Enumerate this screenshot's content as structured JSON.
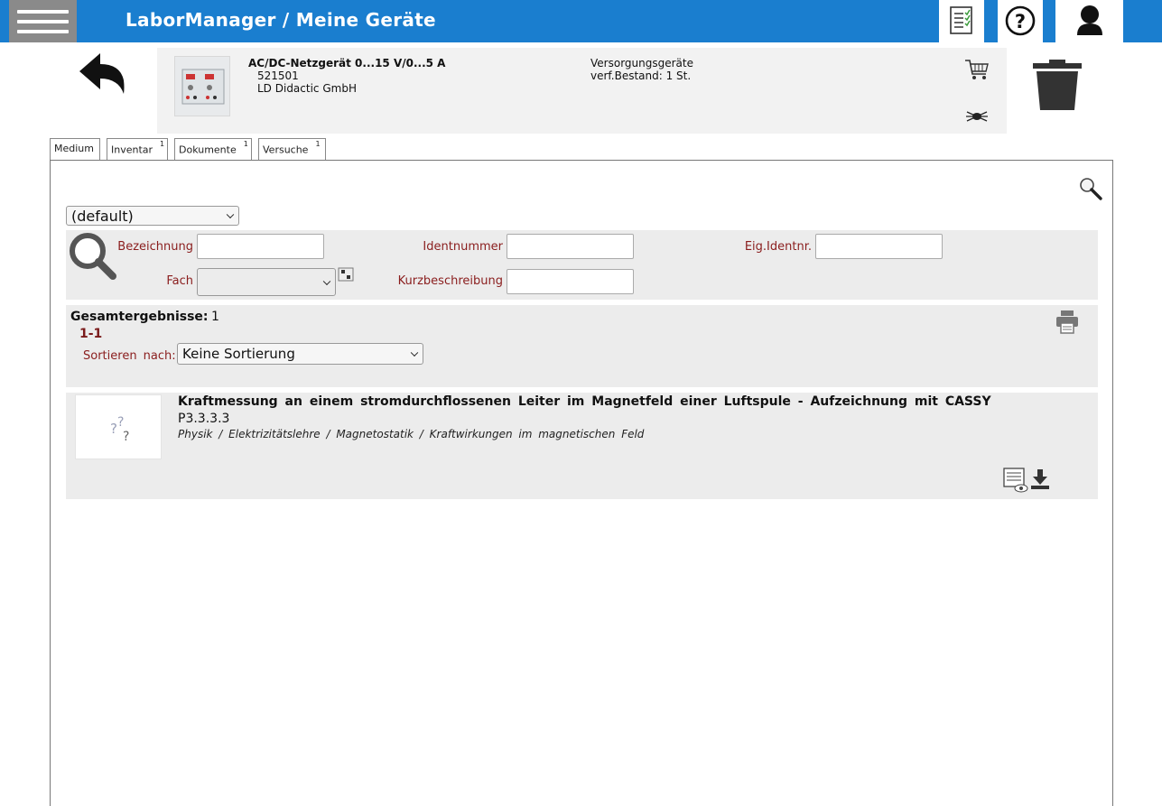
{
  "header": {
    "title": "LaborManager / Meine Geräte",
    "color": "#1a7ecf",
    "icons": [
      "menu-icon",
      "checklist-icon",
      "help-icon",
      "user-icon"
    ]
  },
  "device": {
    "name": "AC/DC-Netzgerät 0...15 V/0...5 A",
    "number": "521501",
    "manufacturer": "LD Didactic GmbH",
    "category": "Versorgungsgeräte",
    "stock": "verf.Bestand: 1 St."
  },
  "tabs": [
    {
      "label": "Medium",
      "count": ""
    },
    {
      "label": "Inventar",
      "count": "1"
    },
    {
      "label": "Dokumente",
      "count": "1"
    },
    {
      "label": "Versuche",
      "count": "1"
    }
  ],
  "view_select": "(default)",
  "filters": {
    "bezeichnung_label": "Bezeichnung",
    "identnummer_label": "Identnummer",
    "eig_identnr_label": "Eig.Identnr.",
    "fach_label": "Fach",
    "kurzbeschreibung_label": "Kurzbeschreibung"
  },
  "results": {
    "total_label": "Gesamtergebnisse:",
    "total_value": "1",
    "range": "1-1",
    "sort_label": "Sortieren nach:",
    "sort_value": "Keine Sortierung"
  },
  "items": [
    {
      "title": "Kraftmessung an einem stromdurchflossenen Leiter im Magnetfeld einer Luftspule - Aufzeichnung mit CASSY",
      "code": "P3.3.3.3",
      "path": "Physik / Elektrizitätslehre / Magnetostatik / Kraftwirkungen im magnetischen Feld"
    }
  ]
}
